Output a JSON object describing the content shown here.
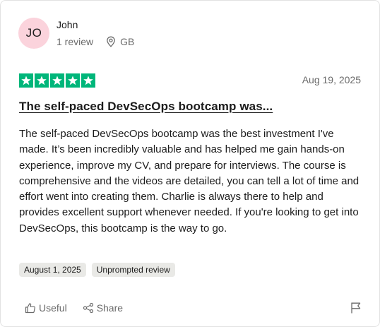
{
  "reviewer": {
    "initials": "JO",
    "name": "John",
    "review_count": "1 review",
    "country": "GB",
    "avatar_color": "#fbd3dc"
  },
  "rating": {
    "stars": 5,
    "max_stars": 5,
    "star_color": "#00b67a",
    "date": "Aug 19, 2025"
  },
  "review": {
    "title": "The self-paced DevSecOps bootcamp was...",
    "body": "The self-paced DevSecOps bootcamp was the best investment I've made. It’s been incredibly valuable and has helped me gain hands-on experience, improve my CV, and prepare for interviews. The course is comprehensive and the videos are detailed, you can tell a lot of time and effort went into creating them. Charlie is always there to help and provides excellent support whenever needed. If you're looking to get into DevSecOps, this bootcamp is the way to go."
  },
  "tags": {
    "experience_date": "August 1, 2025",
    "review_type": "Unprompted review"
  },
  "actions": {
    "useful_label": "Useful",
    "share_label": "Share",
    "useful_icon": "thumbs-up-icon",
    "share_icon": "share-icon",
    "flag_icon": "flag-icon"
  }
}
